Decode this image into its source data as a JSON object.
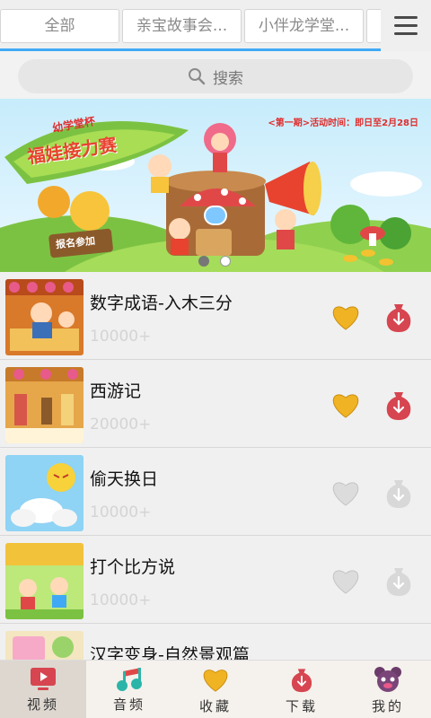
{
  "tabs": [
    {
      "label": "全部"
    },
    {
      "label": "亲宝故事会..."
    },
    {
      "label": "小伴龙学堂..."
    }
  ],
  "search": {
    "label": "搜索"
  },
  "banner": {
    "headline_top": "幼学堂杯",
    "headline_main": "福娃接力赛",
    "date_text": "<第一期>活动时间：即日至2月28日",
    "signup_label": "报名参加",
    "slide_count": 2,
    "active_slide": 0
  },
  "items": [
    {
      "title": "数字成语-入木三分",
      "count": "10000+",
      "status": "saved"
    },
    {
      "title": "西游记",
      "count": "20000+",
      "status": "saved"
    },
    {
      "title": "偷天换日",
      "count": "10000+",
      "status": "none"
    },
    {
      "title": "打个比方说",
      "count": "10000+",
      "status": "none"
    },
    {
      "title": "汉字变身-自然景观篇",
      "count": "",
      "status": "none"
    }
  ],
  "nav": [
    {
      "label": "视频",
      "icon": "video-icon",
      "active": true
    },
    {
      "label": "音频",
      "icon": "music-icon",
      "active": false
    },
    {
      "label": "收藏",
      "icon": "heart-icon",
      "active": false
    },
    {
      "label": "下载",
      "icon": "download-icon",
      "active": false
    },
    {
      "label": "我的",
      "icon": "bear-icon",
      "active": false
    }
  ],
  "colors": {
    "accent": "#3fa9f5",
    "fav_on": "#f0b323",
    "download_on": "#d64550",
    "inactive_icon": "#c8c8c8"
  }
}
